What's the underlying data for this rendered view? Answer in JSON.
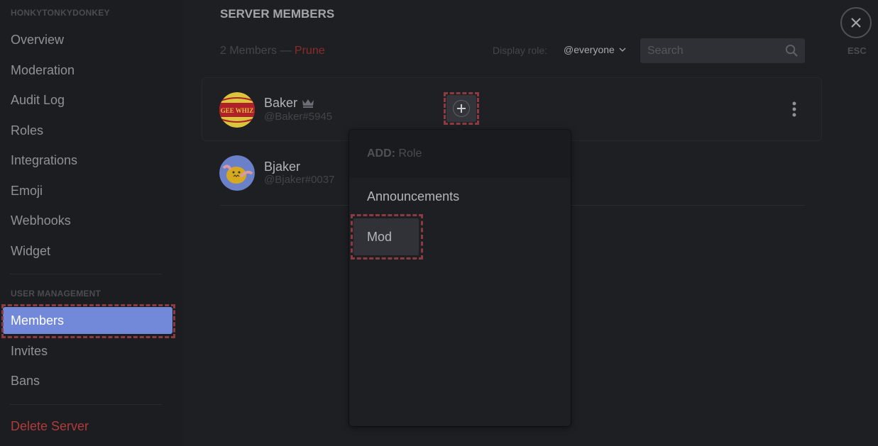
{
  "sidebar": {
    "server_name": "HONKYTONKYDONKEY",
    "items": [
      {
        "label": "Overview"
      },
      {
        "label": "Moderation"
      },
      {
        "label": "Audit Log"
      },
      {
        "label": "Roles"
      },
      {
        "label": "Integrations"
      },
      {
        "label": "Emoji"
      },
      {
        "label": "Webhooks"
      },
      {
        "label": "Widget"
      }
    ],
    "section_user_management": "USER MANAGEMENT",
    "user_items": [
      {
        "label": "Members",
        "active": true
      },
      {
        "label": "Invites"
      },
      {
        "label": "Bans"
      }
    ],
    "delete_server": "Delete Server"
  },
  "main": {
    "title": "SERVER MEMBERS",
    "member_count": "2 Members — ",
    "prune_label": "Prune",
    "display_role_label": "Display role:",
    "display_role_value": "@everyone",
    "search_placeholder": "Search",
    "close_label": "ESC",
    "members": [
      {
        "name": "Baker",
        "tag": "@Baker#5945",
        "owner": true,
        "avatar_text": "GEE WHIZ"
      },
      {
        "name": "Bjaker",
        "tag": "@Bjaker#0037",
        "owner": false
      }
    ]
  },
  "role_popout": {
    "header_prefix": "ADD:",
    "header_placeholder": "Role",
    "roles": [
      {
        "label": "Announcements"
      },
      {
        "label": "Mod",
        "highlighted": true
      }
    ]
  },
  "colors": {
    "accent": "#7289da",
    "danger": "#b13b3b",
    "background": "#1e1f23",
    "sidebar": "#1c1d21"
  }
}
